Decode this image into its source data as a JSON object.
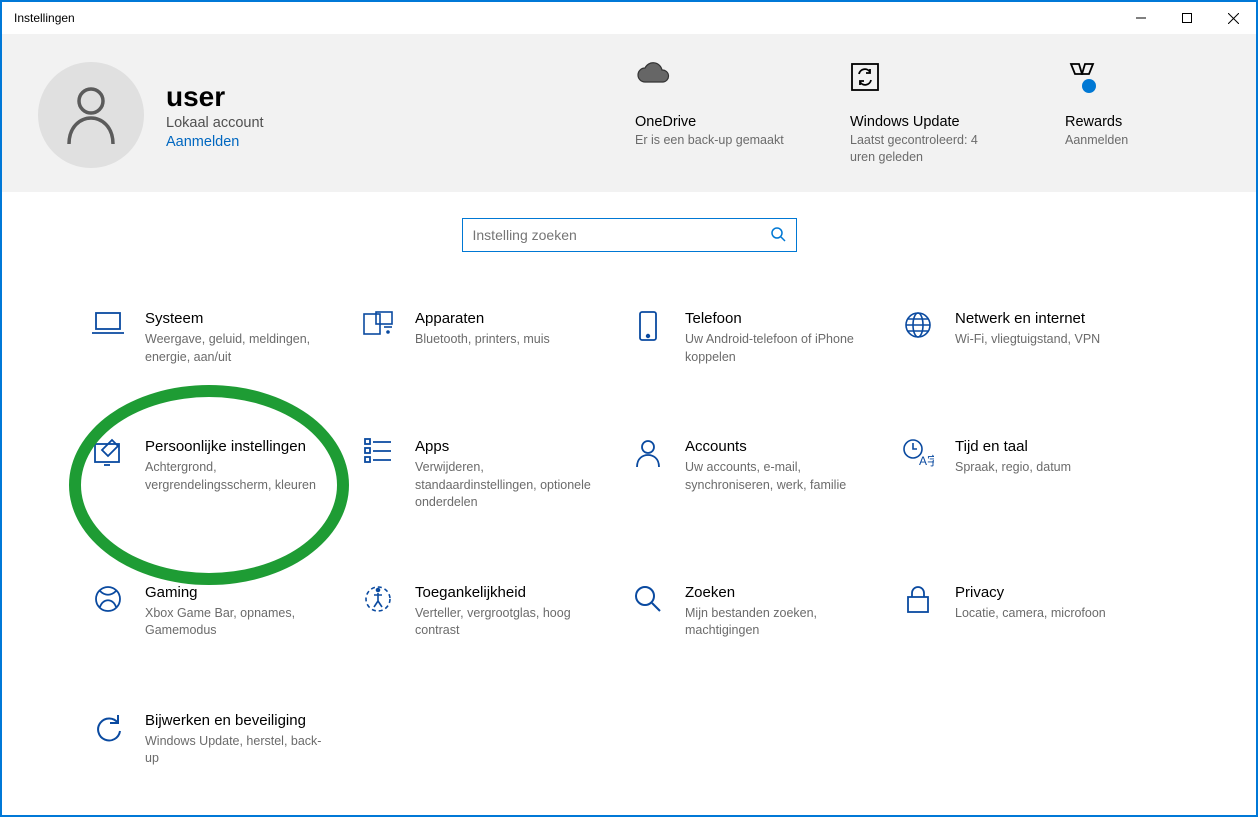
{
  "window": {
    "title": "Instellingen"
  },
  "user": {
    "name": "user",
    "subtitle": "Lokaal account",
    "signin_link": "Aanmelden"
  },
  "header_tiles": {
    "onedrive": {
      "title": "OneDrive",
      "sub": "Er is een back-up gemaakt"
    },
    "update": {
      "title": "Windows Update",
      "sub": "Laatst gecontroleerd: 4 uren geleden"
    },
    "rewards": {
      "title": "Rewards",
      "sub": "Aanmelden"
    }
  },
  "search": {
    "placeholder": "Instelling zoeken"
  },
  "categories": {
    "systeem": {
      "title": "Systeem",
      "sub": "Weergave, geluid, meldingen, energie, aan/uit"
    },
    "apparaten": {
      "title": "Apparaten",
      "sub": "Bluetooth, printers, muis"
    },
    "telefoon": {
      "title": "Telefoon",
      "sub": "Uw Android-telefoon of iPhone koppelen"
    },
    "netwerk": {
      "title": "Netwerk en internet",
      "sub": "Wi-Fi, vliegtuigstand, VPN"
    },
    "pers": {
      "title": "Persoonlijke instellingen",
      "sub": "Achtergrond, vergrendelingsscherm, kleuren"
    },
    "apps": {
      "title": "Apps",
      "sub": "Verwijderen, standaardinstellingen, optionele onderdelen"
    },
    "accounts": {
      "title": "Accounts",
      "sub": "Uw accounts, e-mail, synchroniseren, werk, familie"
    },
    "tijd": {
      "title": "Tijd en taal",
      "sub": "Spraak, regio, datum"
    },
    "gaming": {
      "title": "Gaming",
      "sub": "Xbox Game Bar, opnames, Gamemodus"
    },
    "toegang": {
      "title": "Toegankelijkheid",
      "sub": "Verteller, vergrootglas, hoog contrast"
    },
    "zoeken": {
      "title": "Zoeken",
      "sub": "Mijn bestanden zoeken, machtigingen"
    },
    "privacy": {
      "title": "Privacy",
      "sub": "Locatie, camera, microfoon"
    },
    "update": {
      "title": "Bijwerken en beveiliging",
      "sub": "Windows Update, herstel, back-up"
    }
  }
}
